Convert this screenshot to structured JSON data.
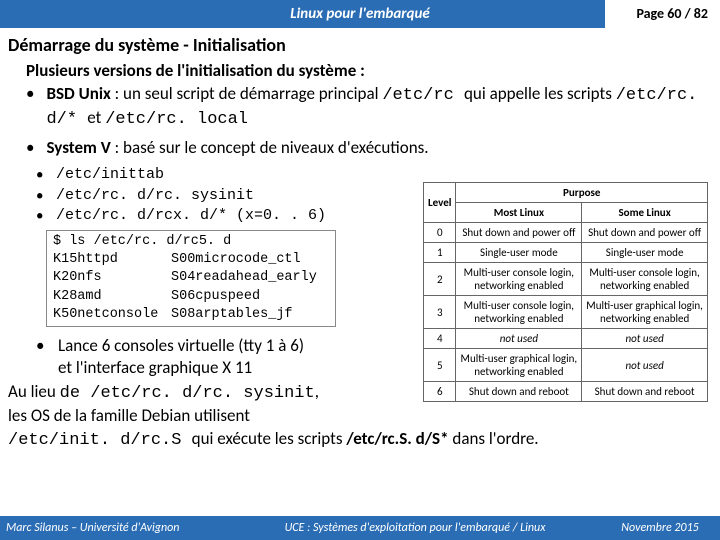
{
  "header": {
    "title": "Linux pour l'embarqué",
    "page": "Page 60 / 82"
  },
  "section": {
    "title": "Démarrage du système - Initialisation",
    "subtitle": "Plusieurs versions de l'initialisation du système :"
  },
  "bullets": {
    "bsd_prefix": "BSD Unix",
    "bsd_mid1": " : un seul script de démarrage principal ",
    "bsd_code1": "/etc/rc ",
    "bsd_mid2": " qui appelle les scripts ",
    "bsd_code2": "/etc/rc. d/* ",
    "bsd_and": " et ",
    "bsd_code3": "/etc/rc. local",
    "sysv_prefix": "System V",
    "sysv_rest": " : basé sur le concept de niveaux d'exécutions."
  },
  "files": {
    "f1": "/etc/inittab",
    "f2": "/etc/rc. d/rc. sysinit",
    "f3": "/etc/rc. d/rcx. d/* (x=0. . 6)"
  },
  "terminal": {
    "prompt": "$ ls /etc/rc. d/rc5. d",
    "rows": [
      [
        "K15httpd",
        "S00microcode_ctl"
      ],
      [
        "K20nfs",
        "S04readahead_early"
      ],
      [
        "K28amd",
        "S06cpuspeed"
      ],
      [
        "K50netconsole",
        "S08arptables_jf"
      ]
    ]
  },
  "bottom": {
    "l1": "Lance 6 consoles virtuelle (tty 1 à 6)",
    "l2": "et l'interface graphique X 11",
    "au_lieu_pre": "Au lieu ",
    "au_lieu_de": "de ",
    "au_lieu_code": "/etc/rc. d/rc. sysinit",
    "comma": ",",
    "debian": "les OS de la famille Debian utilisent",
    "initd_code": "/etc/init. d/rc.S ",
    "initd_mid": " qui exécute les scripts ",
    "initd_bold": "/etc/rc.S. d/S*",
    "initd_end": " dans l'ordre."
  },
  "table": {
    "h_level": "Level",
    "h_purpose": "Purpose",
    "h_most": "Most Linux",
    "h_some": "Some Linux",
    "rows": [
      {
        "lvl": "0",
        "most": "Shut down and power off",
        "some": "Shut down and power off"
      },
      {
        "lvl": "1",
        "most": "Single-user mode",
        "some": "Single-user mode"
      },
      {
        "lvl": "2",
        "most": "Multi-user console login, networking enabled",
        "some": "Multi-user console login, networking enabled"
      },
      {
        "lvl": "3",
        "most": "Multi-user console login, networking enabled",
        "some": "Multi-user graphical login, networking enabled"
      },
      {
        "lvl": "4",
        "most": "not used",
        "some": "not used"
      },
      {
        "lvl": "5",
        "most": "Multi-user graphical login, networking enabled",
        "some": "not used"
      },
      {
        "lvl": "6",
        "most": "Shut down and reboot",
        "some": "Shut down and reboot"
      }
    ]
  },
  "footer": {
    "left": "Marc Silanus – Université d'Avignon",
    "center": "UCE : Systèmes d'exploitation pour l'embarqué / Linux",
    "right": "Novembre 2015"
  }
}
